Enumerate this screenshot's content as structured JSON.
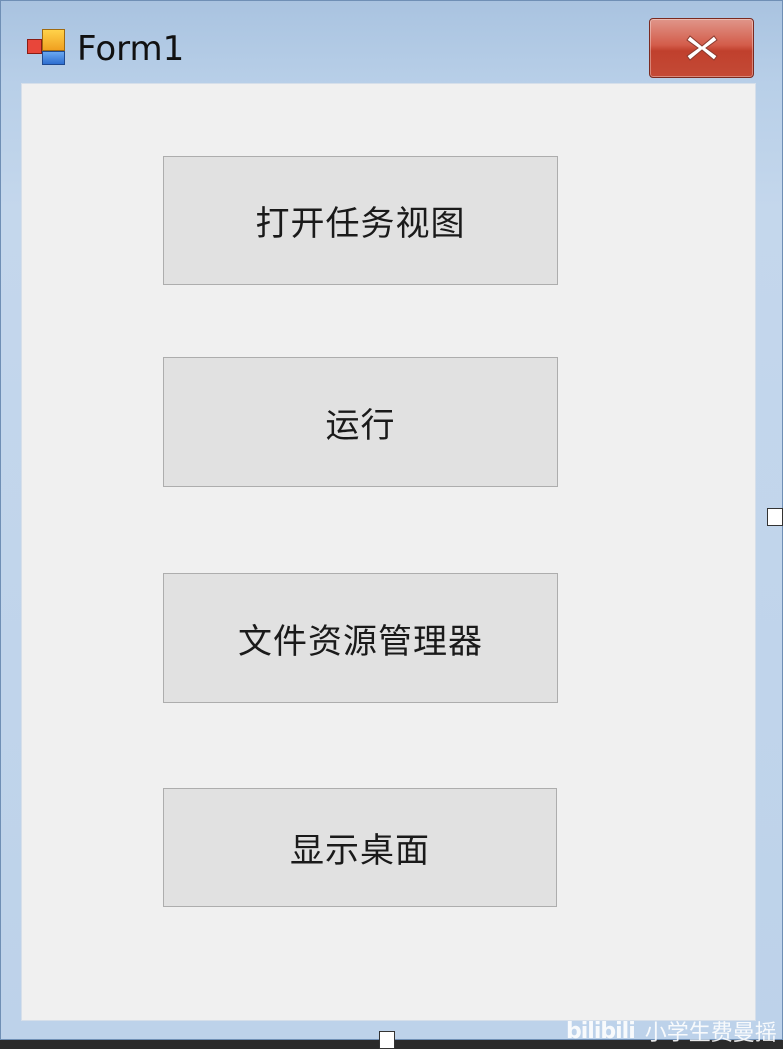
{
  "window": {
    "title": "Form1",
    "close_icon": "close-x-icon",
    "app_icon": "winforms-form-icon"
  },
  "buttons": [
    {
      "label": "打开任务视图"
    },
    {
      "label": "运行"
    },
    {
      "label": "文件资源管理器"
    },
    {
      "label": "显示桌面"
    }
  ],
  "watermark": {
    "logo": "bilibili",
    "text": "小学生费曼摇"
  },
  "colors": {
    "client_bg": "#f0f0f0",
    "button_bg": "#e1e1e1",
    "button_border": "#adadad",
    "close_red": "#c44a36",
    "frame_blue": "#bdd2ea"
  }
}
